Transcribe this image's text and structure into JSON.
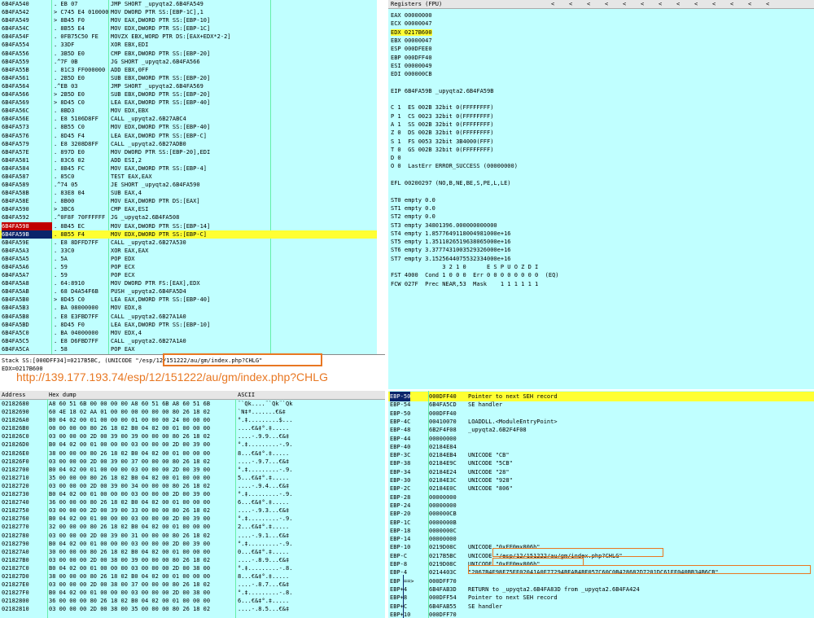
{
  "cpu": {
    "rows": [
      {
        "addr": "6B4FA540",
        "hex": ". EB 07",
        "dis": "JMP SHORT _upyqta2.6B4FA549",
        "com": ""
      },
      {
        "addr": "6B4FA542",
        "hex": "> C745 E4 010000",
        "dis": "MOV DWORD PTR SS:[EBP-1C],1",
        "com": ""
      },
      {
        "addr": "6B4FA549",
        "hex": "> 8B45 F0",
        "dis": "MOV EAX,DWORD PTR SS:[EBP-10]",
        "com": ""
      },
      {
        "addr": "6B4FA54C",
        "hex": ". 8B55 E4",
        "dis": "MOV EDX,DWORD PTR SS:[EBP-1C]",
        "com": ""
      },
      {
        "addr": "6B4FA54F",
        "hex": ". 0FB75C50 FE",
        "dis": "MOVZX EBX,WORD PTR DS:[EAX+EDX*2-2]",
        "com": ""
      },
      {
        "addr": "6B4FA554",
        "hex": ". 33DF",
        "dis": "XOR EBX,EDI",
        "com": ""
      },
      {
        "addr": "6B4FA556",
        "hex": ". 3B5D E0",
        "dis": "CMP EBX,DWORD PTR SS:[EBP-20]",
        "com": ""
      },
      {
        "addr": "6B4FA559",
        "hex": ".^7F 0B",
        "dis": "JG SHORT _upyqta2.6B4FA566",
        "com": ""
      },
      {
        "addr": "6B4FA55B",
        "hex": ". 81C3 FF000000",
        "dis": "ADD EBX,0FF",
        "com": ""
      },
      {
        "addr": "6B4FA561",
        "hex": ". 2B5D E0",
        "dis": "SUB EBX,DWORD PTR SS:[EBP-20]",
        "com": ""
      },
      {
        "addr": "6B4FA564",
        "hex": ".^EB 03",
        "dis": "JMP SHORT _upyqta2.6B4FA569",
        "com": ""
      },
      {
        "addr": "6B4FA566",
        "hex": "> 2B5D E0",
        "dis": "SUB EBX,DWORD PTR SS:[EBP-20]",
        "com": ""
      },
      {
        "addr": "6B4FA569",
        "hex": "> 8D45 C0",
        "dis": "LEA EAX,DWORD PTR SS:[EBP-40]",
        "com": ""
      },
      {
        "addr": "6B4FA56C",
        "hex": ". 8BD3",
        "dis": "MOV EDX,EBX",
        "com": ""
      },
      {
        "addr": "6B4FA56E",
        "hex": ". E8 5106D8FF",
        "dis": "CALL _upyqta2.6B27ABC4",
        "com": ""
      },
      {
        "addr": "6B4FA573",
        "hex": ". 8B55 C0",
        "dis": "MOV EDX,DWORD PTR SS:[EBP-40]",
        "com": ""
      },
      {
        "addr": "6B4FA576",
        "hex": ". 8D45 F4",
        "dis": "LEA EAX,DWORD PTR SS:[EBP-C]",
        "com": ""
      },
      {
        "addr": "6B4FA579",
        "hex": ". E8 3208D8FF",
        "dis": "CALL _upyqta2.6B27ADB0",
        "com": ""
      },
      {
        "addr": "6B4FA57E",
        "hex": ". 897D E0",
        "dis": "MOV DWORD PTR SS:[EBP-20],EDI",
        "com": ""
      },
      {
        "addr": "6B4FA581",
        "hex": ". 83C6 02",
        "dis": "ADD ESI,2",
        "com": ""
      },
      {
        "addr": "6B4FA584",
        "hex": ". 8B45 FC",
        "dis": "MOV EAX,DWORD PTR SS:[EBP-4]",
        "com": ""
      },
      {
        "addr": "6B4FA587",
        "hex": ". 85C0",
        "dis": "TEST EAX,EAX",
        "com": ""
      },
      {
        "addr": "6B4FA589",
        "hex": ".^74 05",
        "dis": "JE SHORT _upyqta2.6B4FA590",
        "com": ""
      },
      {
        "addr": "6B4FA58B",
        "hex": ". 83E8 04",
        "dis": "SUB EAX,4",
        "com": ""
      },
      {
        "addr": "6B4FA58E",
        "hex": ". 8B00",
        "dis": "MOV EAX,DWORD PTR DS:[EAX]",
        "com": ""
      },
      {
        "addr": "6B4FA590",
        "hex": "> 3BC6",
        "dis": "CMP EAX,ESI",
        "com": ""
      },
      {
        "addr": "6B4FA592",
        "hex": ".^0F8F 70FFFFFF",
        "dis": "JG _upyqta2.6B4FA508",
        "com": ""
      },
      {
        "addr": "6B4FA598",
        "hex": ". 8B45 EC",
        "dis": "MOV EAX,DWORD PTR SS:[EBP-14]",
        "com": ""
      },
      {
        "addr": "6B4FA59B",
        "hex": ". 8B55 F4",
        "dis": "MOV EDX,DWORD PTR SS:[EBP-C]",
        "com": ""
      },
      {
        "addr": "6B4FA59E",
        "hex": ". E8 8DFFD7FF",
        "dis": "CALL _upyqta2.6B27A530",
        "com": ""
      },
      {
        "addr": "6B4FA5A3",
        "hex": ". 33C0",
        "dis": "XOR EAX,EAX",
        "com": ""
      },
      {
        "addr": "6B4FA5A5",
        "hex": ". 5A",
        "dis": "POP EDX",
        "com": ""
      },
      {
        "addr": "6B4FA5A6",
        "hex": ". 59",
        "dis": "POP ECX",
        "com": ""
      },
      {
        "addr": "6B4FA5A7",
        "hex": ". 59",
        "dis": "POP ECX",
        "com": ""
      },
      {
        "addr": "6B4FA5A8",
        "hex": ". 64:8910",
        "dis": "MOV DWORD PTR FS:[EAX],EDX",
        "com": ""
      },
      {
        "addr": "6B4FA5AB",
        "hex": ". 68 D4A54F6B",
        "dis": "PUSH _upyqta2.6B4FA5D4",
        "com": ""
      },
      {
        "addr": "6B4FA5B0",
        "hex": "> 8D45 C0",
        "dis": "LEA EAX,DWORD PTR SS:[EBP-40]",
        "com": ""
      },
      {
        "addr": "6B4FA5B3",
        "hex": ". BA 08000000",
        "dis": "MOV EDX,8",
        "com": ""
      },
      {
        "addr": "6B4FA5B8",
        "hex": ". E8 E3FBD7FF",
        "dis": "CALL _upyqta2.6B27A1A0",
        "com": ""
      },
      {
        "addr": "6B4FA5BD",
        "hex": ". 8D45 F0",
        "dis": "LEA EAX,DWORD PTR SS:[EBP-10]",
        "com": ""
      },
      {
        "addr": "6B4FA5C0",
        "hex": ". BA 04000000",
        "dis": "MOV EDX,4",
        "com": ""
      },
      {
        "addr": "6B4FA5C5",
        "hex": ". E8 D6FBD7FF",
        "dis": "CALL _upyqta2.6B27A1A0",
        "com": ""
      },
      {
        "addr": "6B4FA5CA",
        "hex": ". 58",
        "dis": "POP EAX",
        "com": ""
      }
    ]
  },
  "info": {
    "line1_prefix": "Stack SS:[000DFF34]=0217B5BC, (UNICODE ",
    "line1_value": "\"/esp/12/151222/au/gm/index.php?CHLG\"",
    "line2": "EDX=0217B600"
  },
  "annotation_url": "http://139.177.193.74/esp/12/151222/au/gm/index.php?CHLG",
  "registers": {
    "title": "Registers (FPU)",
    "arrows": [
      "<",
      "<",
      "<",
      "<",
      "<",
      "<",
      "<",
      "<",
      "<",
      "<",
      "<",
      "<",
      "<"
    ],
    "lines": [
      {
        "t": "EAX 00000000",
        "hl": false
      },
      {
        "t": "ECX 00000047",
        "hl": false
      },
      {
        "t": "EDX 0217B600",
        "hl": true
      },
      {
        "t": "EBX 00000047",
        "hl": false
      },
      {
        "t": "ESP 000DFEE0",
        "hl": false
      },
      {
        "t": "EBP 000DFF40",
        "hl": false
      },
      {
        "t": "ESI 00000049",
        "hl": false
      },
      {
        "t": "EDI 000000CB",
        "hl": false
      },
      {
        "t": "",
        "hl": false
      },
      {
        "t": "EIP 6B4FA59B _upyqta2.6B4FA59B",
        "hl": false
      },
      {
        "t": "",
        "hl": false
      },
      {
        "t": "C 1  ES 002B 32bit 0(FFFFFFFF)",
        "hl": false
      },
      {
        "t": "P 1  CS 0023 32bit 0(FFFFFFFF)",
        "hl": false
      },
      {
        "t": "A 1  SS 002B 32bit 0(FFFFFFFF)",
        "hl": false
      },
      {
        "t": "Z 0  DS 002B 32bit 0(FFFFFFFF)",
        "hl": false
      },
      {
        "t": "S 1  FS 0053 32bit 3B4000(FFF)",
        "hl": false
      },
      {
        "t": "T 0  GS 002B 32bit 0(FFFFFFFF)",
        "hl": false
      },
      {
        "t": "D 0",
        "hl": false
      },
      {
        "t": "O 0  LastErr ERROR_SUCCESS (00000000)",
        "hl": false
      },
      {
        "t": "",
        "hl": false
      },
      {
        "t": "EFL 00200297 (NO,B,NE,BE,S,PE,L,LE)",
        "hl": false
      },
      {
        "t": "",
        "hl": false
      },
      {
        "t": "ST0 empty 0.0",
        "hl": false
      },
      {
        "t": "ST1 empty 0.0",
        "hl": false
      },
      {
        "t": "ST2 empty 0.0",
        "hl": false
      },
      {
        "t": "ST3 empty 34801396.000000000000",
        "hl": false
      },
      {
        "t": "ST4 empty 1.8577649118004981000e+16",
        "hl": false
      },
      {
        "t": "ST5 empty 1.3511026519638065000e+16",
        "hl": false
      },
      {
        "t": "ST6 empty 3.3777431003529326000e+16",
        "hl": false
      },
      {
        "t": "ST7 empty 3.1525644075532334000e+16",
        "hl": false
      },
      {
        "t": "               3 2 1 0      E S P U O Z D I",
        "hl": false
      },
      {
        "t": "FST 4000  Cond 1 0 0 0  Err 0 0 0 0 0 0 0 0  (EQ)",
        "hl": false
      },
      {
        "t": "FCW 027F  Prec NEAR,53  Mask    1 1 1 1 1 1",
        "hl": false
      }
    ]
  },
  "dump": {
    "headers": {
      "address": "Address",
      "hex": "Hex dump",
      "ascii": "ASCII"
    },
    "rows": [
      {
        "a": "02182680",
        "h": "A8 60 51 6B 00 00 00 00 A8 60 51 6B A8 60 51 6B",
        "s": "¨`Qk....¨`Qk¨`Qk"
      },
      {
        "a": "02182690",
        "h": "60 4E 18 02 AA 01 00 00 00 00 00 00 80 26 18 02",
        "s": "`N‡ª.......€&‡"
      },
      {
        "a": "021826A0",
        "h": "B0 04 02 00 01 00 00 00 01 00 00 00 24 00 00 00",
        "s": "°.‡.........$..."
      },
      {
        "a": "021826B0",
        "h": "00 00 00 00 80 26 18 02 B0 04 02 00 01 00 00 00",
        "s": "....€&‡°.‡....."
      },
      {
        "a": "021826C0",
        "h": "03 00 00 00 2D 00 39 00 39 00 00 00 80 26 18 02",
        "s": "....-.9.9...€&‡"
      },
      {
        "a": "021826D0",
        "h": "B0 04 02 00 01 00 00 00 03 00 00 00 2D 00 39 00",
        "s": "°.‡.........-.9."
      },
      {
        "a": "021826E0",
        "h": "38 00 00 00 80 26 18 02 B0 04 02 00 01 00 00 00",
        "s": "8...€&‡°.‡....."
      },
      {
        "a": "021826F0",
        "h": "03 00 00 00 2D 00 39 00 37 00 00 00 80 26 18 02",
        "s": "....-.9.7...€&‡"
      },
      {
        "a": "02182700",
        "h": "B0 04 02 00 01 00 00 00 03 00 00 00 2D 00 39 00",
        "s": "°.‡.........-.9."
      },
      {
        "a": "02182710",
        "h": "35 00 00 00 80 26 18 02 B0 04 02 00 01 00 00 00",
        "s": "5...€&‡°.‡....."
      },
      {
        "a": "02182720",
        "h": "03 00 00 00 2D 00 39 00 34 00 00 00 80 26 18 02",
        "s": "....-.9.4...€&‡"
      },
      {
        "a": "02182730",
        "h": "B0 04 02 00 01 00 00 00 03 00 00 00 2D 00 39 00",
        "s": "°.‡.........-.9."
      },
      {
        "a": "02182740",
        "h": "36 00 00 00 80 26 18 02 B0 04 02 00 01 00 00 00",
        "s": "6...€&‡°.‡....."
      },
      {
        "a": "02182750",
        "h": "03 00 00 00 2D 00 39 00 33 00 00 00 80 26 18 02",
        "s": "....-.9.3...€&‡"
      },
      {
        "a": "02182760",
        "h": "B0 04 02 00 01 00 00 00 03 00 00 00 2D 00 39 00",
        "s": "°.‡.........-.9."
      },
      {
        "a": "02182770",
        "h": "32 00 00 00 80 26 18 02 B0 04 02 00 01 00 00 00",
        "s": "2...€&‡°.‡....."
      },
      {
        "a": "02182780",
        "h": "03 00 00 00 2D 00 39 00 31 00 00 00 80 26 18 02",
        "s": "....-.9.1...€&‡"
      },
      {
        "a": "02182790",
        "h": "B0 04 02 00 01 00 00 00 03 00 00 00 2D 00 39 00",
        "s": "°.‡.........-.9."
      },
      {
        "a": "021827A0",
        "h": "30 00 00 00 80 26 18 02 B0 04 02 00 01 00 00 00",
        "s": "0...€&‡°.‡....."
      },
      {
        "a": "021827B0",
        "h": "03 00 00 00 2D 00 38 00 39 00 00 00 80 26 18 02",
        "s": "....-.8.9...€&‡"
      },
      {
        "a": "021827C0",
        "h": "B0 04 02 00 01 00 00 00 03 00 00 00 2D 00 38 00",
        "s": "°.‡.........-.8."
      },
      {
        "a": "021827D0",
        "h": "38 00 00 00 80 26 18 02 B0 04 02 00 01 00 00 00",
        "s": "8...€&‡°.‡....."
      },
      {
        "a": "021827E0",
        "h": "03 00 00 00 2D 00 38 00 37 00 00 00 80 26 18 02",
        "s": "....-.8.7...€&‡"
      },
      {
        "a": "021827F0",
        "h": "B0 04 02 00 01 00 00 00 03 00 00 00 2D 00 38 00",
        "s": "°.‡.........-.8."
      },
      {
        "a": "02182800",
        "h": "36 00 00 00 80 26 18 02 B0 04 02 00 01 00 00 00",
        "s": "6...€&‡°.‡....."
      },
      {
        "a": "02182810",
        "h": "03 00 00 00 2D 00 38 00 35 00 00 00 80 26 18 02",
        "s": "....-.8.5...€&‡"
      }
    ]
  },
  "stack": {
    "rows": [
      {
        "o": "EBP-50",
        "v": "000DFF40",
        "c": "Pointer to next SEH record",
        "hl": true
      },
      {
        "o": "EBP-54",
        "v": "6B4FA5CD",
        "c": "SE handler",
        "hl": false
      },
      {
        "o": "EBP-50",
        "v": "000DFF40",
        "c": "",
        "hl": false
      },
      {
        "o": "EBP-4C",
        "v": "00410070",
        "c": "LOADDLL.<ModuleEntryPoint>",
        "hl": false
      },
      {
        "o": "EBP-48",
        "v": "6B2F4F08",
        "c": "_upyqta2.6B2F4F08",
        "hl": false
      },
      {
        "o": "EBP-44",
        "v": "00000000",
        "c": "",
        "hl": false
      },
      {
        "o": "EBP-40",
        "v": "02184E84",
        "c": "",
        "hl": false
      },
      {
        "o": "EBP-3C",
        "v": "02184EB4",
        "c": "UNICODE \"CB\"",
        "hl": false
      },
      {
        "o": "EBP-38",
        "v": "02184E9C",
        "c": "UNICODE \"5CB\"",
        "hl": false
      },
      {
        "o": "EBP-34",
        "v": "02184E24",
        "c": "UNICODE \"28\"",
        "hl": false
      },
      {
        "o": "EBP-30",
        "v": "02184E3C",
        "c": "UNICODE \"928\"",
        "hl": false
      },
      {
        "o": "EBP-2C",
        "v": "02184E0C",
        "c": "UNICODE \"806\"",
        "hl": false
      },
      {
        "o": "EBP-28",
        "v": "00000000",
        "c": "",
        "hl": false
      },
      {
        "o": "EBP-24",
        "v": "00000000",
        "c": "",
        "hl": false
      },
      {
        "o": "EBP-20",
        "v": "000000CB",
        "c": "",
        "hl": false
      },
      {
        "o": "EBP-1C",
        "v": "0000000B",
        "c": "",
        "hl": false
      },
      {
        "o": "EBP-18",
        "v": "0000000C",
        "c": "",
        "hl": false
      },
      {
        "o": "EBP-14",
        "v": "00000000",
        "c": "",
        "hl": false
      },
      {
        "o": "EBP-10",
        "v": "0219D08C",
        "c": "UNICODE \"0xFF0mx806h\"",
        "hl": false
      },
      {
        "o": "EBP-C",
        "v": "0217B5BC",
        "c": "UNICODE \"/esp/12/151222/au/gm/index.php?CHLG\"",
        "hl": false
      },
      {
        "o": "EBP-8",
        "v": "0219D08C",
        "c": "UNICODE \"0xFF0mx806h\"",
        "hl": false
      },
      {
        "o": "EBP-4",
        "v": "0214403C",
        "c": "\"2067B4E98F75EE02041A0E77294BEAB4BF057C60C0B428682D7201DC61FF040BB34B6CB\"",
        "hl": false
      },
      {
        "o": "EBP ==>",
        "v": "000DFF70",
        "c": "",
        "hl": false
      },
      {
        "o": "EBP+4",
        "v": "6B4FAB3D",
        "c": "RETURN to _upyqta2.6B4FA83D from _upyqta2.6B4FA424",
        "hl": false
      },
      {
        "o": "EBP+8",
        "v": "000DFF54",
        "c": "Pointer to next SEH record",
        "hl": false
      },
      {
        "o": "EBP+C",
        "v": "6B4FAB55",
        "c": "SE handler",
        "hl": false
      },
      {
        "o": "EBP+10",
        "v": "000DFF70",
        "c": "",
        "hl": false
      }
    ]
  }
}
